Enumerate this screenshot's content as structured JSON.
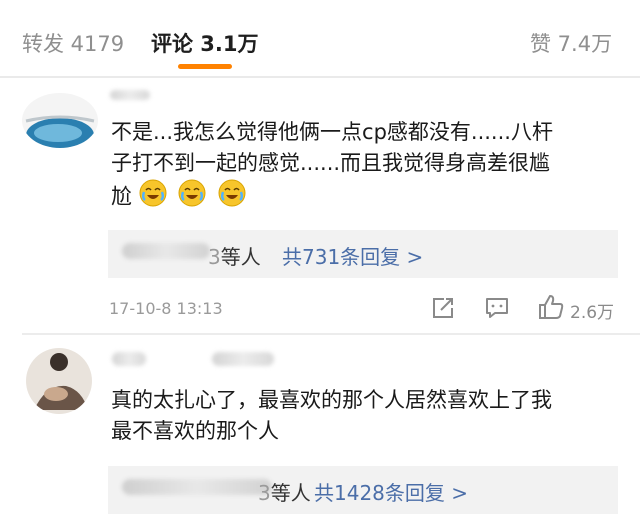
{
  "tabs": {
    "repost_label": "转发 4179",
    "comments_label": "评论 3.1万",
    "likes_label": "赞 7.4万"
  },
  "colors": {
    "accent": "#ff8200",
    "link": "#4b6ea8",
    "reply_bg": "#f2f2f2"
  },
  "comments": [
    {
      "text_line1": "不是...我怎么觉得他俩一点cp感都没有......八杆",
      "text_line2": "子打不到一起的感觉......而且我觉得身高差很尴",
      "text_line3": "尬",
      "emoji_names": [
        "laugh-cry-emoji",
        "laugh-cry-emoji",
        "laugh-cry-emoji"
      ],
      "reply_suffix": "等人",
      "reply_link": "共731条回复 >",
      "time": "17-10-8 13:13",
      "like_count": "2.6万"
    },
    {
      "text_line1": "真的太扎心了，最喜欢的那个人居然喜欢上了我",
      "text_line2": "最不喜欢的那个人",
      "reply_suffix": "等人",
      "reply_link": "共1428条回复 >"
    }
  ]
}
